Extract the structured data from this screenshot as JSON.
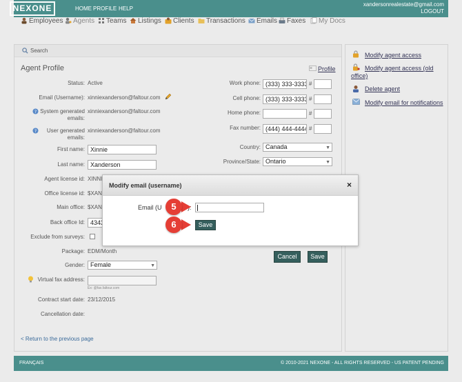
{
  "header": {
    "logo": "NEXONE",
    "nav": [
      "HOME",
      "PROFILE",
      "HELP"
    ],
    "account_email": "xandersonrealestate@gmail.com",
    "logout": "LOGOUT"
  },
  "main_nav": [
    {
      "label": "Employees",
      "icon": "employees-icon"
    },
    {
      "label": "Agents",
      "icon": "agents-icon"
    },
    {
      "label": "Teams",
      "icon": "teams-icon"
    },
    {
      "label": "Listings",
      "icon": "listings-icon"
    },
    {
      "label": "Clients",
      "icon": "clients-icon"
    },
    {
      "label": "Transactions",
      "icon": "transactions-icon"
    },
    {
      "label": "Emails",
      "icon": "emails-icon"
    },
    {
      "label": "Faxes",
      "icon": "faxes-icon"
    },
    {
      "label": "My Docs",
      "icon": "mydocs-icon"
    }
  ],
  "search_label": "Search",
  "profile": {
    "title": "Agent Profile",
    "profile_link": "Profile",
    "status_label": "Status:",
    "status_value": "Active",
    "email_label": "Email (Username):",
    "email_value": "xinniexanderson@faltour.com",
    "sys_email_label_1": "System generated",
    "sys_email_label_2": "emails:",
    "sys_email_value": "xinniexanderson@faltour.com",
    "user_email_label_1": "User generated",
    "user_email_label_2": "emails:",
    "user_email_value": "xinniexanderson@faltour.com",
    "first_name_label": "First name:",
    "first_name_value": "Xinnie",
    "last_name_label": "Last name:",
    "last_name_value": "Xanderson",
    "license_label": "Agent license id:",
    "license_value": "XINNI",
    "office_license_label": "Office license id:",
    "office_license_value": "$XAN",
    "main_office_label": "Main office:",
    "main_office_value": "$XAN",
    "back_office_label": "Back office Id:",
    "back_office_value": "4343",
    "exclude_label": "Exclude from surveys:",
    "package_label": "Package:",
    "package_value": "EDM/Month",
    "gender_label": "Gender:",
    "gender_value": "Female",
    "fax_label": "Virtual fax address:",
    "fax_hint": "Ex: @fax.faltour.com",
    "contract_label": "Contract start date:",
    "contract_value": "23/12/2015",
    "cancel_date_label": "Cancellation date:",
    "work_phone_label": "Work phone:",
    "work_phone_value": "(333) 333-3333",
    "cell_phone_label": "Cell phone:",
    "cell_phone_value": "(333) 333-3333",
    "home_phone_label": "Home phone:",
    "fax_number_label": "Fax number:",
    "fax_number_value": "(444) 444-4444",
    "ext_mark": "#",
    "country_label": "Country:",
    "country_value": "Canada",
    "province_label": "Province/State:",
    "province_value": "Ontario",
    "cancel_button": "Cancel",
    "save_button": "Save",
    "return_link": "< Return to the previous page"
  },
  "sidebar": [
    {
      "label": "Modify agent access",
      "icon": "lock-icon"
    },
    {
      "label": "Modify agent access (old office)",
      "icon": "lock-key-icon"
    },
    {
      "label": "Delete agent",
      "icon": "delete-user-icon"
    },
    {
      "label": "Modify email for notifications",
      "icon": "envelope-icon"
    }
  ],
  "dialog": {
    "title": "Modify email (username)",
    "close": "×",
    "email_label_start": "Email (U",
    "email_label_end": "):",
    "email_value": "",
    "save_button": "Save"
  },
  "badges": [
    "5",
    "6"
  ],
  "footer": {
    "language": "FRANÇAIS",
    "copyright": "© 2010-2021 NEXONE - ALL RIGHTS RESERVED - US PATENT PENDING"
  },
  "colors": {
    "brand": "#4a8f8c",
    "button_dark": "#355f5d",
    "badge": "#e53e35"
  }
}
